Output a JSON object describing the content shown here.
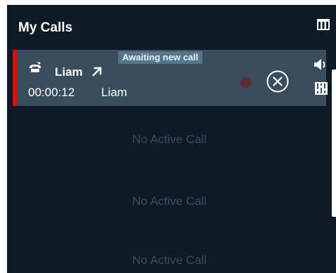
{
  "header": {
    "title": "My Calls",
    "columns_icon": "columns-icon"
  },
  "active_call": {
    "status": "Awaiting new call",
    "caller_name": "Liam",
    "timer": "00:00:12",
    "party": "Liam",
    "accent_color": "#e00d0d",
    "icons": [
      "phone-icon",
      "open-external-icon",
      "record-icon",
      "close-circle-icon",
      "volume-icon",
      "mixer-icon"
    ]
  },
  "slots": [
    {
      "label": "No Active Call"
    },
    {
      "label": "No Active Call"
    },
    {
      "label": "No Active Call"
    }
  ],
  "colors": {
    "panel_bg": "#0e1a26",
    "card_bg": "#3a4d5c",
    "badge_bg": "#55778d",
    "muted_text": "#3c4c5a"
  }
}
